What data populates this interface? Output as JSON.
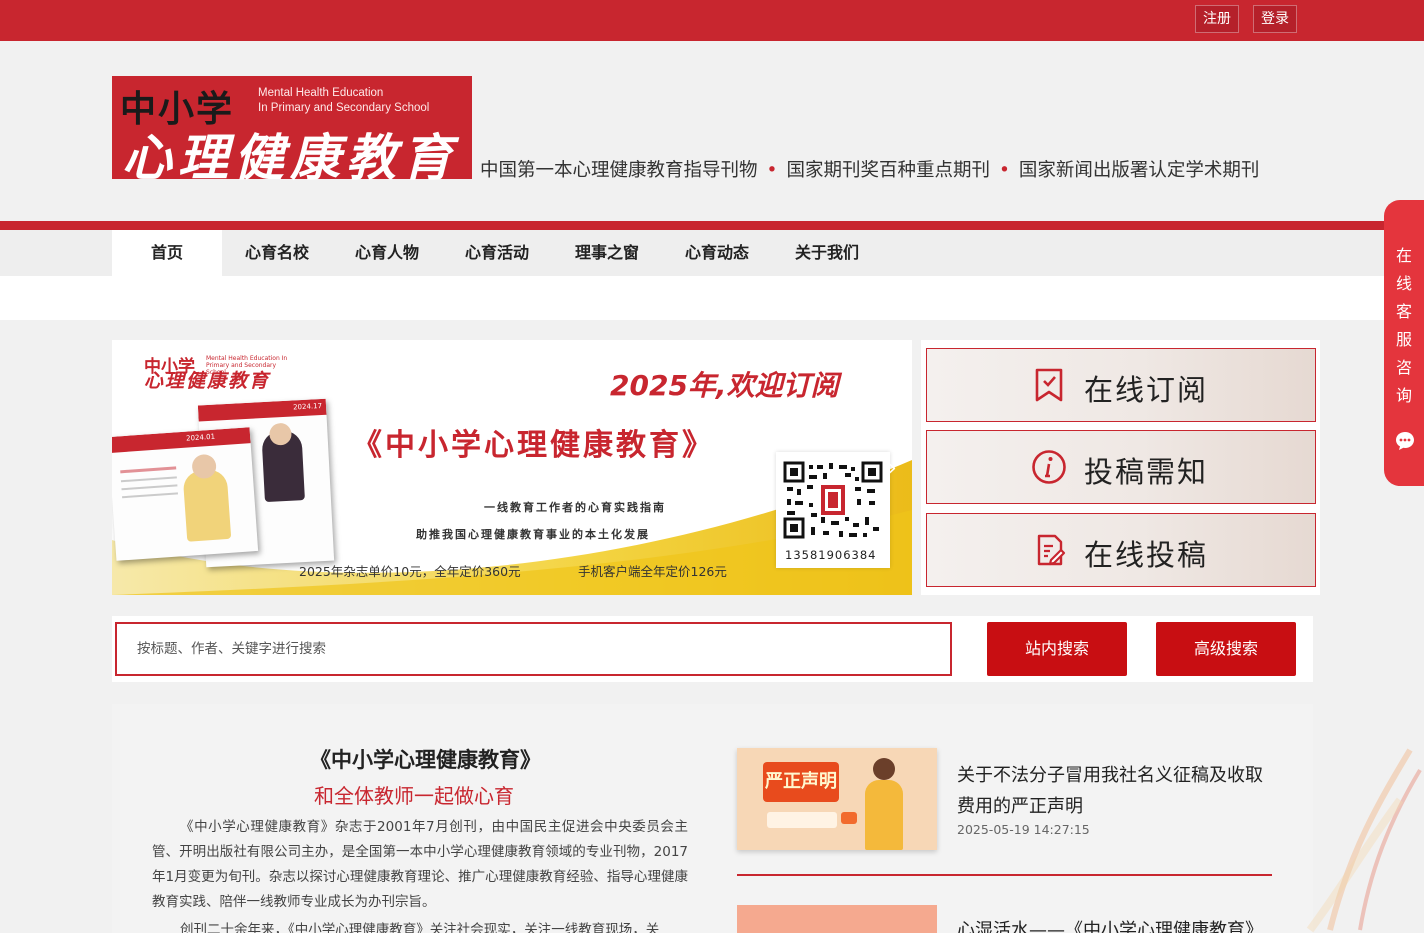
{
  "topbar": {
    "register_label": "注册",
    "login_label": "登录"
  },
  "logo": {
    "cn_top": "中小学",
    "en_line1": "Mental Health Education",
    "en_line2": "In Primary and Secondary School",
    "cn_big": "心理健康教育"
  },
  "slogan": {
    "items": [
      "中国第一本心理健康教育指导刊物",
      "国家期刊奖百种重点期刊",
      "国家新闻出版署认定学术期刊"
    ],
    "separator": "•"
  },
  "nav": {
    "items": [
      {
        "label": "首页",
        "active": true
      },
      {
        "label": "心育名校"
      },
      {
        "label": "心育人物"
      },
      {
        "label": "心育活动"
      },
      {
        "label": "理事之窗"
      },
      {
        "label": "心育动态"
      },
      {
        "label": "关于我们"
      }
    ]
  },
  "banner": {
    "logo_cn1": "中小学",
    "logo_cn2": "心理健康教育",
    "logo_en": "Mental Health Education In Primary and Secondary School",
    "headline": "2025年,欢迎订阅",
    "title": "《中小学心理健康教育》",
    "tagline1": "一线教育工作者的心育实践指南",
    "tagline2": "助推我国心理健康教育事业的本土化发展",
    "price1": "2025年杂志单价10元，全年定价360元",
    "price2": "手机客户端全年定价126元",
    "qr_phone": "13581906384",
    "mag_label_a": "2024.17",
    "mag_label_b": "2024.01"
  },
  "side_buttons": {
    "subscribe": "在线订阅",
    "notice": "投稿需知",
    "submit": "在线投稿"
  },
  "search": {
    "placeholder": "按标题、作者、关键字进行搜索",
    "site_button": "站内搜索",
    "advanced_button": "高级搜索"
  },
  "intro": {
    "title": "《中小学心理健康教育》",
    "subtitle": "和全体教师一起做心育",
    "paragraph": "《中小学心理健康教育》杂志于2001年7月创刊，由中国民主促进会中央委员会主管、开明出版社有限公司主办，是全国第一本中小学心理健康教育领域的专业刊物，2017年1月变更为旬刊。杂志以探讨心理健康教育理论、推广心理健康教育经验、指导心理健康教育实践、陪伴一线教师专业成长为办刊宗旨。",
    "paragraph2": "创刊二十余年来，《中小学心理健康教育》关注社会现实，关注一线教育现场，关"
  },
  "news": [
    {
      "image_text": "严正声明",
      "title": "关于不法分子冒用我社名义征稿及收取费用的严正声明",
      "date": "2025-05-19 14:27:15"
    },
    {
      "title": "心湿活水——《中小学心理健康教育》"
    }
  ],
  "float_service": {
    "label": "在线客服咨询"
  },
  "colors": {
    "brand_red": "#c8262f",
    "button_red": "#c80e12",
    "float_red": "#e4353d"
  }
}
